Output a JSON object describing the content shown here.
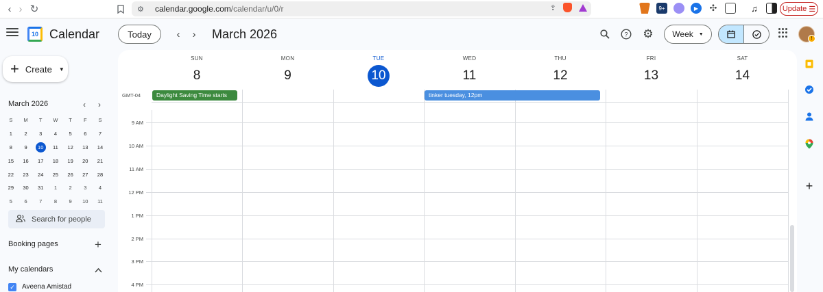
{
  "browser": {
    "url_host": "calendar.google.com",
    "url_path": "/calendar/u/0/r",
    "update_label": "Update"
  },
  "header": {
    "app_title": "Calendar",
    "logo_day": "10",
    "today_label": "Today",
    "month_title": "March 2026",
    "view_label": "Week"
  },
  "sidebar": {
    "create_label": "Create",
    "mini_calendar": {
      "title": "March 2026",
      "weekdays": [
        "S",
        "M",
        "T",
        "W",
        "T",
        "F",
        "S"
      ],
      "weeks": [
        [
          "1",
          "2",
          "3",
          "4",
          "5",
          "6",
          "7"
        ],
        [
          "8",
          "9",
          "10",
          "11",
          "12",
          "13",
          "14"
        ],
        [
          "15",
          "16",
          "17",
          "18",
          "19",
          "20",
          "21"
        ],
        [
          "22",
          "23",
          "24",
          "25",
          "26",
          "27",
          "28"
        ],
        [
          "29",
          "30",
          "31",
          "1",
          "2",
          "3",
          "4"
        ],
        [
          "5",
          "6",
          "7",
          "8",
          "9",
          "10",
          "11"
        ]
      ]
    },
    "search_people_placeholder": "Search for people",
    "booking_pages_label": "Booking pages",
    "my_calendars_label": "My calendars",
    "calendar_owner": "Aveena Amistad"
  },
  "week": {
    "timezone": "GMT-04",
    "days": [
      {
        "dow": "SUN",
        "date": "8"
      },
      {
        "dow": "MON",
        "date": "9"
      },
      {
        "dow": "TUE",
        "date": "10"
      },
      {
        "dow": "WED",
        "date": "11"
      },
      {
        "dow": "THU",
        "date": "12"
      },
      {
        "dow": "FRI",
        "date": "13"
      },
      {
        "dow": "SAT",
        "date": "14"
      }
    ],
    "times": [
      "9 AM",
      "10 AM",
      "11 AM",
      "12 PM",
      "1 PM",
      "2 PM",
      "3 PM",
      "4 PM"
    ],
    "events": {
      "dst": "Daylight Saving Time starts",
      "tinker_title": "tinker tuesday",
      "tinker_time": ", 12pm"
    }
  },
  "colors": {
    "accent": "#0b57d0",
    "event_green": "#33b679",
    "event_dst": "#3c8a3e",
    "event_blue": "#4a8fe0"
  }
}
